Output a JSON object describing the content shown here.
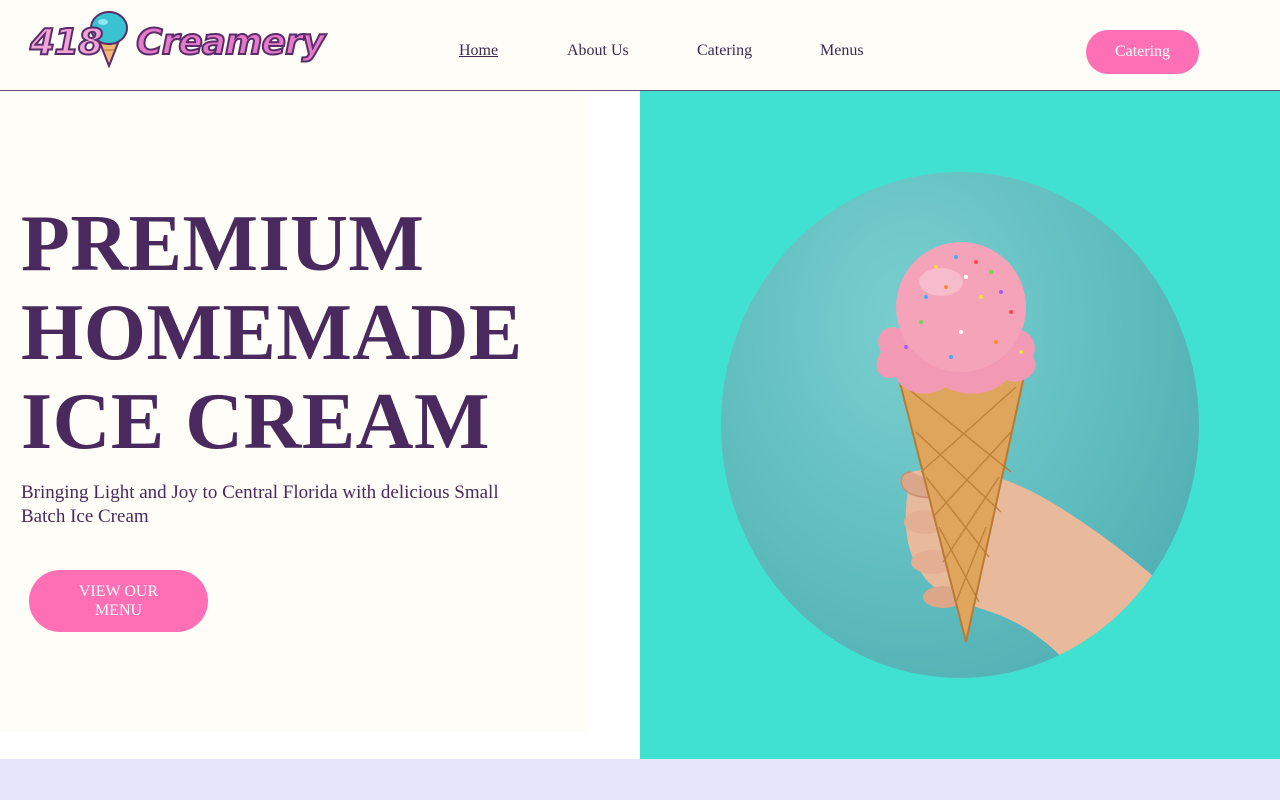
{
  "brand": {
    "logo_number": "418",
    "logo_word": "Creamery"
  },
  "nav": {
    "items": [
      {
        "label": "Home",
        "active": true
      },
      {
        "label": "About Us",
        "active": false
      },
      {
        "label": "Catering",
        "active": false
      },
      {
        "label": "Menus",
        "active": false
      }
    ],
    "cta_label": "Catering"
  },
  "hero": {
    "title_lines": [
      "PREMIUM",
      "HOMEMADE",
      "ICE CREAM"
    ],
    "subtitle": "Bringing Light and Joy to Central Florida with delicious Small Batch Ice Cream",
    "cta_label": "VIEW OUR MENU",
    "image_subject": "hand-holding-pink-ice-cream-cone-with-sprinkles"
  },
  "colors": {
    "accent_pink": "#ff6fb5",
    "brand_purple": "#4a2a5e",
    "teal_panel": "#41e1d1",
    "cream_bg": "#fefdf7",
    "lavender_band": "#e5e5f9"
  }
}
